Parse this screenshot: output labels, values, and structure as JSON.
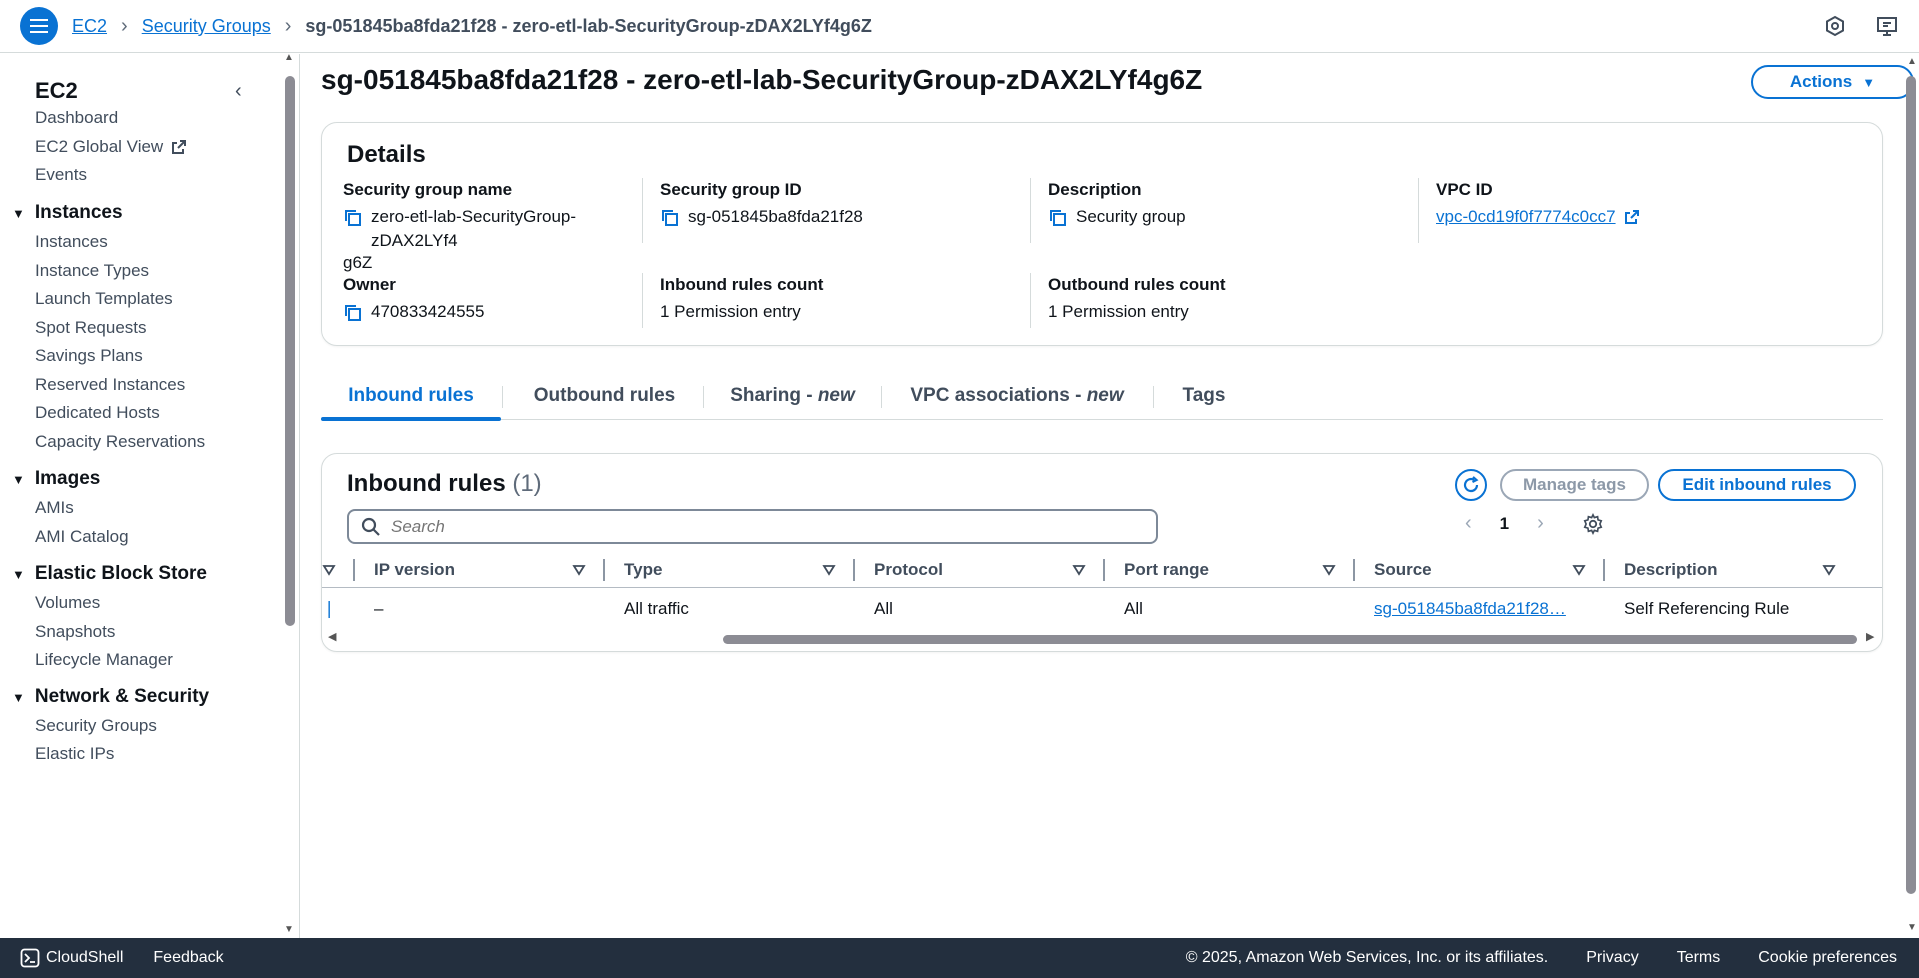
{
  "breadcrumb": {
    "root": "EC2",
    "parent": "Security Groups",
    "current": "sg-051845ba8fda21f28 - zero-etl-lab-SecurityGroup-zDAX2LYf4g6Z"
  },
  "sidebar": {
    "title": "EC2",
    "top_items": [
      "Dashboard",
      "EC2 Global View",
      "Events"
    ],
    "sections": [
      {
        "title": "Instances",
        "items": [
          "Instances",
          "Instance Types",
          "Launch Templates",
          "Spot Requests",
          "Savings Plans",
          "Reserved Instances",
          "Dedicated Hosts",
          "Capacity Reservations"
        ]
      },
      {
        "title": "Images",
        "items": [
          "AMIs",
          "AMI Catalog"
        ]
      },
      {
        "title": "Elastic Block Store",
        "items": [
          "Volumes",
          "Snapshots",
          "Lifecycle Manager"
        ]
      },
      {
        "title": "Network & Security",
        "items": [
          "Security Groups",
          "Elastic IPs"
        ]
      }
    ]
  },
  "page": {
    "title": "sg-051845ba8fda21f28 - zero-etl-lab-SecurityGroup-zDAX2LYf4g6Z",
    "actions_label": "Actions"
  },
  "details": {
    "title": "Details",
    "sg_name_label": "Security group name",
    "sg_name_line1": "zero-etl-lab-SecurityGroup-zDAX2LYf4",
    "sg_name_line2": "g6Z",
    "sg_id_label": "Security group ID",
    "sg_id": "sg-051845ba8fda21f28",
    "description_label": "Description",
    "description": "Security group",
    "vpc_label": "VPC ID",
    "vpc_id": "vpc-0cd19f0f7774c0cc7",
    "owner_label": "Owner",
    "owner": "470833424555",
    "inbound_label": "Inbound rules count",
    "inbound": "1 Permission entry",
    "outbound_label": "Outbound rules count",
    "outbound": "1 Permission entry"
  },
  "tabs": {
    "inbound": "Inbound rules",
    "outbound": "Outbound rules",
    "sharing": "Sharing - ",
    "sharing_new": "new",
    "vpc_assoc": "VPC associations - ",
    "vpc_new": "new",
    "tags": "Tags"
  },
  "rules": {
    "title": "Inbound rules",
    "count": "(1)",
    "manage_tags": "Manage tags",
    "edit": "Edit inbound rules",
    "search_placeholder": "Search",
    "page": "1",
    "columns": [
      "IP version",
      "Type",
      "Protocol",
      "Port range",
      "Source",
      "Description"
    ],
    "row": {
      "ip_version": "–",
      "type": "All traffic",
      "protocol": "All",
      "port_range": "All",
      "source": "sg-051845ba8fda21f28…",
      "description": "Self Referencing Rule"
    }
  },
  "footer": {
    "cloudshell": "CloudShell",
    "feedback": "Feedback",
    "copyright": "© 2025, Amazon Web Services, Inc. or its affiliates.",
    "privacy": "Privacy",
    "terms": "Terms",
    "cookies": "Cookie preferences"
  },
  "colors": {
    "accent": "#0972d3",
    "footer_bg": "#232f3e",
    "text": "#0f141a"
  }
}
